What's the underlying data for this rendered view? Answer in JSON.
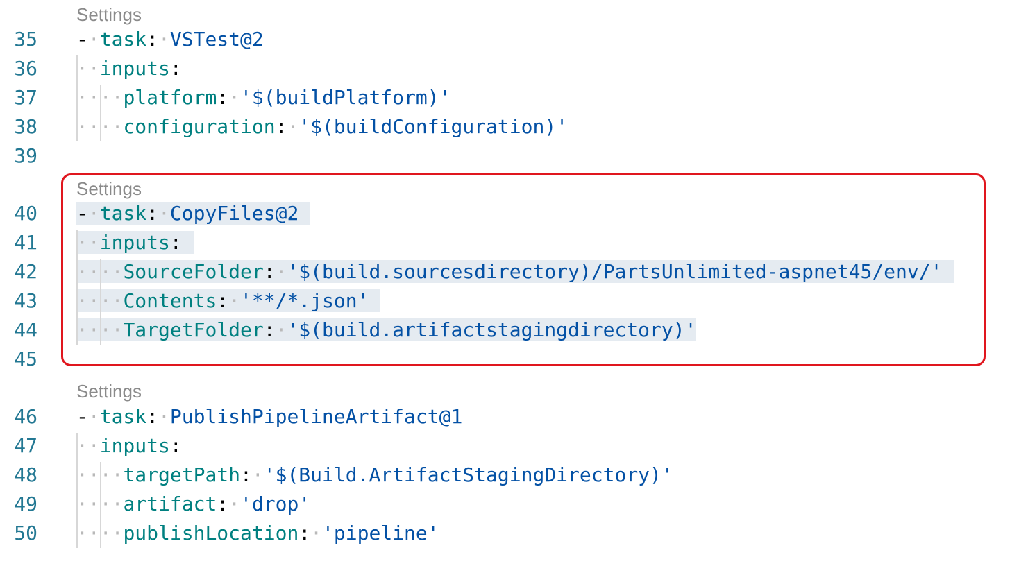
{
  "codelens": {
    "block1": "Settings",
    "block2": "Settings",
    "block3": "Settings"
  },
  "lines": [
    {
      "num": "35",
      "key": "task",
      "value": "VSTest@2"
    },
    {
      "num": "36",
      "key": "inputs"
    },
    {
      "num": "37",
      "key": "platform",
      "value": "'$(buildPlatform)'"
    },
    {
      "num": "38",
      "key": "configuration",
      "value": "'$(buildConfiguration)'"
    },
    {
      "num": "39"
    },
    {
      "num": "40",
      "key": "task",
      "value": "CopyFiles@2"
    },
    {
      "num": "41",
      "key": "inputs"
    },
    {
      "num": "42",
      "key": "SourceFolder",
      "value": "'$(build.sourcesdirectory)/PartsUnlimited-aspnet45/env/'"
    },
    {
      "num": "43",
      "key": "Contents",
      "value": "'**/*.json'"
    },
    {
      "num": "44",
      "key": "TargetFolder",
      "value": "'$(build.artifactstagingdirectory)'"
    },
    {
      "num": "45"
    },
    {
      "num": "46",
      "key": "task",
      "value": "PublishPipelineArtifact@1"
    },
    {
      "num": "47",
      "key": "inputs"
    },
    {
      "num": "48",
      "key": "targetPath",
      "value": "'$(Build.ArtifactStagingDirectory)'"
    },
    {
      "num": "49",
      "key": "artifact",
      "value": "'drop'"
    },
    {
      "num": "50",
      "key": "publishLocation",
      "value": "'pipeline'"
    }
  ],
  "colors": {
    "key": "#008080",
    "value": "#0451a5",
    "line_number": "#237893",
    "selection": "#e5ebf1",
    "highlight_border": "#e0161e",
    "codelens": "#8a8a8a"
  }
}
